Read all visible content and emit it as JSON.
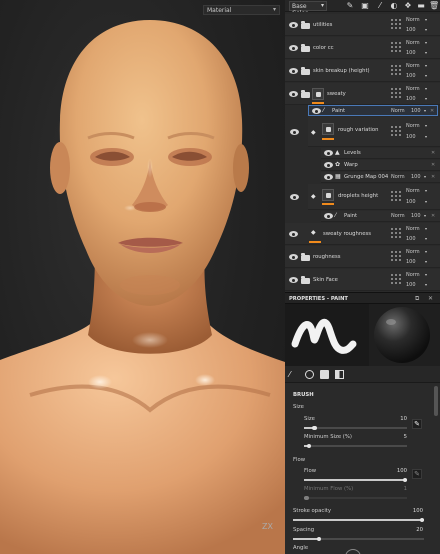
{
  "viewport": {
    "mode_label": "Material",
    "axis_label": "Z",
    "axis_label_2": "X",
    "icons": [
      "chevron-down-icon",
      "axis-gizmo-icon"
    ]
  },
  "toolbar": {
    "channel": "Base Color",
    "icons": [
      "paint-brush-icon",
      "add-fill-icon",
      "add-layer-icon",
      "add-mask-icon",
      "add-effect-icon",
      "add-folder-icon",
      "delete-icon"
    ]
  },
  "layers": {
    "default_blend": "Norm",
    "default_opacity": "100",
    "rows": [
      {
        "name": "utilities",
        "blend": "Norm",
        "opacity": "100"
      },
      {
        "name": "color cc",
        "blend": "Norm",
        "opacity": "100"
      },
      {
        "name": "skin breakup (height)",
        "blend": "Norm",
        "opacity": "100"
      },
      {
        "name": "sweaty",
        "blend": "Norm",
        "opacity": "100"
      },
      {
        "name": "Paint",
        "blend": "Norm",
        "opacity": "100"
      },
      {
        "name": "rough variation",
        "blend": "Norm",
        "opacity": "100"
      },
      {
        "name": "Levels"
      },
      {
        "name": "Warp"
      },
      {
        "name": "Grunge Map 004",
        "blend": "Norm",
        "opacity": "100"
      },
      {
        "name": "droplets height",
        "blend": "Norm",
        "opacity": "100"
      },
      {
        "name": "Paint",
        "blend": "Norm",
        "opacity": "100"
      },
      {
        "name": "sweaty roughness",
        "blend": "Norm",
        "opacity": "100"
      },
      {
        "name": "roughness",
        "blend": "Norm",
        "opacity": "100"
      },
      {
        "name": "Skin Face",
        "blend": "Norm",
        "opacity": "100"
      }
    ],
    "accent_color": "#f08a1c",
    "selection_color": "#4a79b8"
  },
  "properties": {
    "title": "PROPERTIES - PAINT",
    "icons": [
      "popout-icon",
      "close-icon"
    ],
    "tabs": [
      "brush-tab",
      "material-tab",
      "stencil-tab",
      "alpha-tab"
    ]
  },
  "brush": {
    "section": "BRUSH",
    "size_group": "Size",
    "size_label": "Size",
    "size_value": "10",
    "min_size_label": "Minimum Size (%)",
    "min_size_value": "5",
    "flow_group": "Flow",
    "flow_label": "Flow",
    "flow_value": "100",
    "min_flow_label": "Minimum Flow (%)",
    "min_flow_value": "1",
    "stroke_opacity_label": "Stroke opacity",
    "stroke_opacity_value": "100",
    "spacing_label": "Spacing",
    "spacing_value": "20",
    "angle_label": "Angle",
    "size_fraction": 0.1,
    "min_size_fraction": 0.05,
    "flow_fraction": 1.0,
    "min_flow_fraction": 0.01,
    "stroke_opacity_fraction": 1.0,
    "spacing_fraction": 0.2
  }
}
